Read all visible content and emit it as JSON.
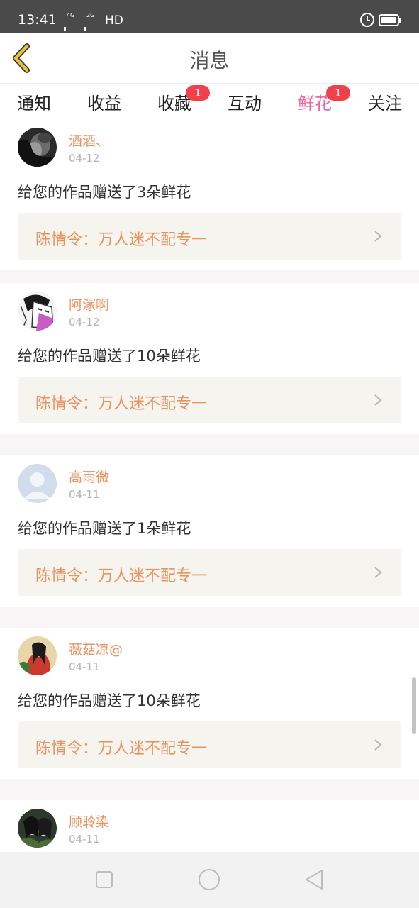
{
  "status_bar": {
    "time": "13:41",
    "network1_label": "4G",
    "network2_label": "2G",
    "hd_label": "HD",
    "icons": [
      "signal-icon",
      "alarm-icon",
      "battery-icon"
    ]
  },
  "header": {
    "title": "消息",
    "back_icon": "back-arrow-icon",
    "back_icon_color": "#e9c23b"
  },
  "tabs": [
    {
      "label": "通知",
      "badge": null,
      "active": false
    },
    {
      "label": "收益",
      "badge": null,
      "active": false
    },
    {
      "label": "收藏",
      "badge": "1",
      "active": false
    },
    {
      "label": "互动",
      "badge": null,
      "active": false
    },
    {
      "label": "鲜花",
      "badge": "1",
      "active": true
    },
    {
      "label": "关注",
      "badge": null,
      "active": false
    }
  ],
  "colors": {
    "active_tab": "#e96aa3",
    "username": "#e8925e",
    "badge": "#f0404a",
    "work_box_bg": "#f6f4ee"
  },
  "messages": [
    {
      "user": "酒酒、",
      "date": "04-12",
      "text": "给您的作品赠送了3朵鲜花",
      "work_title": "陈情令：万人迷不配专一",
      "avatar": "avatar-photo"
    },
    {
      "user": "阿溕啊",
      "date": "04-12",
      "text": "给您的作品赠送了10朵鲜花",
      "work_title": "陈情令：万人迷不配专一",
      "avatar": "avatar-drawing"
    },
    {
      "user": "高雨微",
      "date": "04-11",
      "text": "给您的作品赠送了1朵鲜花",
      "work_title": "陈情令：万人迷不配专一",
      "avatar": "avatar-default"
    },
    {
      "user": "薇菇凉@",
      "date": "04-11",
      "text": "给您的作品赠送了10朵鲜花",
      "work_title": "陈情令：万人迷不配专一",
      "avatar": "avatar-photo"
    },
    {
      "user": "顾聆染",
      "date": "04-11",
      "text": "",
      "work_title": "",
      "avatar": "avatar-photo"
    }
  ],
  "nav_bar": {
    "icons": [
      "recent-apps-icon",
      "home-icon",
      "back-icon"
    ]
  }
}
